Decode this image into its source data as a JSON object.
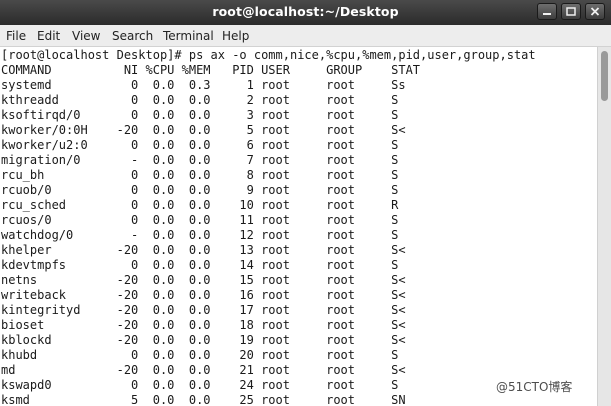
{
  "window": {
    "title": "root@localhost:~/Desktop",
    "buttons": [
      "minimize-icon",
      "maximize-icon",
      "close-icon"
    ]
  },
  "menubar": {
    "items": [
      "File",
      "Edit",
      "View",
      "Search",
      "Terminal",
      "Help"
    ]
  },
  "terminal": {
    "command_line": "[root@localhost Desktop]# ps ax -o comm,nice,%cpu,%mem,pid,user,group,stat",
    "header": "COMMAND          NI %CPU %MEM   PID USER     GROUP    STAT",
    "rows": [
      "systemd           0  0.0  0.3     1 root     root     Ss",
      "kthreadd          0  0.0  0.0     2 root     root     S",
      "ksoftirqd/0       0  0.0  0.0     3 root     root     S",
      "kworker/0:0H    -20  0.0  0.0     5 root     root     S<",
      "kworker/u2:0      0  0.0  0.0     6 root     root     S",
      "migration/0       -  0.0  0.0     7 root     root     S",
      "rcu_bh            0  0.0  0.0     8 root     root     S",
      "rcuob/0           0  0.0  0.0     9 root     root     S",
      "rcu_sched         0  0.0  0.0    10 root     root     R",
      "rcuos/0           0  0.0  0.0    11 root     root     S",
      "watchdog/0        -  0.0  0.0    12 root     root     S",
      "khelper         -20  0.0  0.0    13 root     root     S<",
      "kdevtmpfs         0  0.0  0.0    14 root     root     S",
      "netns           -20  0.0  0.0    15 root     root     S<",
      "writeback       -20  0.0  0.0    16 root     root     S<",
      "kintegrityd     -20  0.0  0.0    17 root     root     S<",
      "bioset          -20  0.0  0.0    18 root     root     S<",
      "kblockd         -20  0.0  0.0    19 root     root     S<",
      "khubd             0  0.0  0.0    20 root     root     S",
      "md              -20  0.0  0.0    21 root     root     S<",
      "kswapd0           0  0.0  0.0    24 root     root     S",
      "ksmd              5  0.0  0.0    25 root     root     SN"
    ]
  },
  "watermark": "@51CTO博客",
  "colors": {
    "titlebar": "#2f2f2f",
    "menubar": "#ededed",
    "terminal_bg": "#ffffff",
    "terminal_fg": "#1a1a1a"
  }
}
